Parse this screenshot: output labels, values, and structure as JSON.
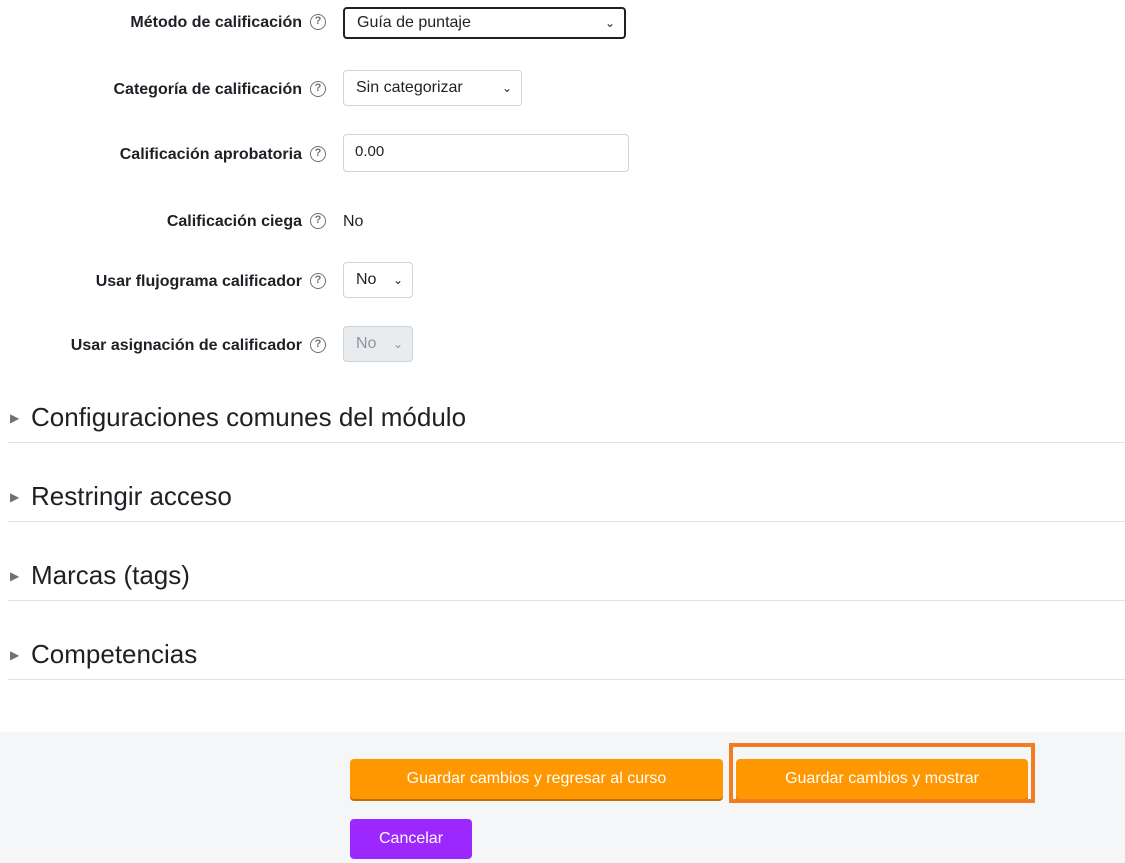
{
  "fields": {
    "grading_method": {
      "label": "Método de calificación",
      "value": "Guía de puntaje"
    },
    "grade_category": {
      "label": "Categoría de calificación",
      "value": "Sin categorizar"
    },
    "grade_to_pass": {
      "label": "Calificación aprobatoria",
      "value": "0.00"
    },
    "blind_marking": {
      "label": "Calificación ciega",
      "value": "No"
    },
    "marking_workflow": {
      "label": "Usar flujograma calificador",
      "value": "No"
    },
    "marking_allocation": {
      "label": "Usar asignación de calificador",
      "value": "No"
    }
  },
  "help_glyph": "?",
  "sections": [
    {
      "title": "Configuraciones comunes del módulo"
    },
    {
      "title": "Restringir acceso"
    },
    {
      "title": "Marcas (tags)"
    },
    {
      "title": "Competencias"
    }
  ],
  "buttons": {
    "save_return": "Guardar cambios y regresar al curso",
    "save_display": "Guardar cambios y mostrar",
    "cancel": "Cancelar"
  },
  "colors": {
    "primary_button": "#ff9800",
    "cancel_button": "#9c27ff",
    "highlight_border": "#f47c20"
  },
  "icons": {
    "chevron": "chevron-down-icon",
    "collapse": "caret-right-icon",
    "help": "question-circle-icon"
  }
}
